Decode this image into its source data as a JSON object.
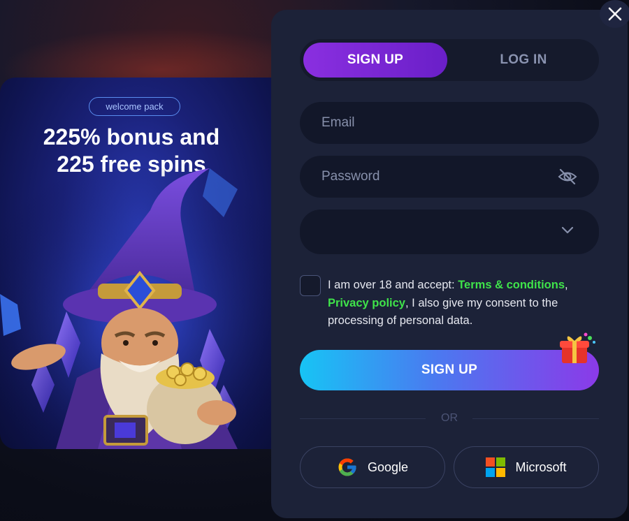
{
  "promo": {
    "badge": "welcome pack",
    "title_line1": "225% bonus and",
    "title_line2": "225 free spins"
  },
  "tabs": {
    "signup": "SIGN UP",
    "login": "LOG IN",
    "active": "signup"
  },
  "form": {
    "email_placeholder": "Email",
    "password_placeholder": "Password",
    "select_value": ""
  },
  "terms": {
    "prefix": "I am over 18 and accept: ",
    "terms_link": "Terms & conditions",
    "comma": ",",
    "privacy_link": "Privacy policy",
    "suffix": ", I also give my consent to the processing of personal data."
  },
  "actions": {
    "signup_button": "SIGN UP",
    "or_label": "OR"
  },
  "social": {
    "google": "Google",
    "microsoft": "Microsoft"
  },
  "icons": {
    "close": "close-icon",
    "eye": "eye-slash-icon",
    "chevron": "chevron-down-icon",
    "gift": "gift-icon",
    "google": "google-logo-icon",
    "microsoft": "microsoft-logo-icon"
  },
  "colors": {
    "accent_purple": "#8a2fe0",
    "link_green": "#3fe34a",
    "modal_bg": "#1c2238",
    "field_bg": "#121729"
  }
}
